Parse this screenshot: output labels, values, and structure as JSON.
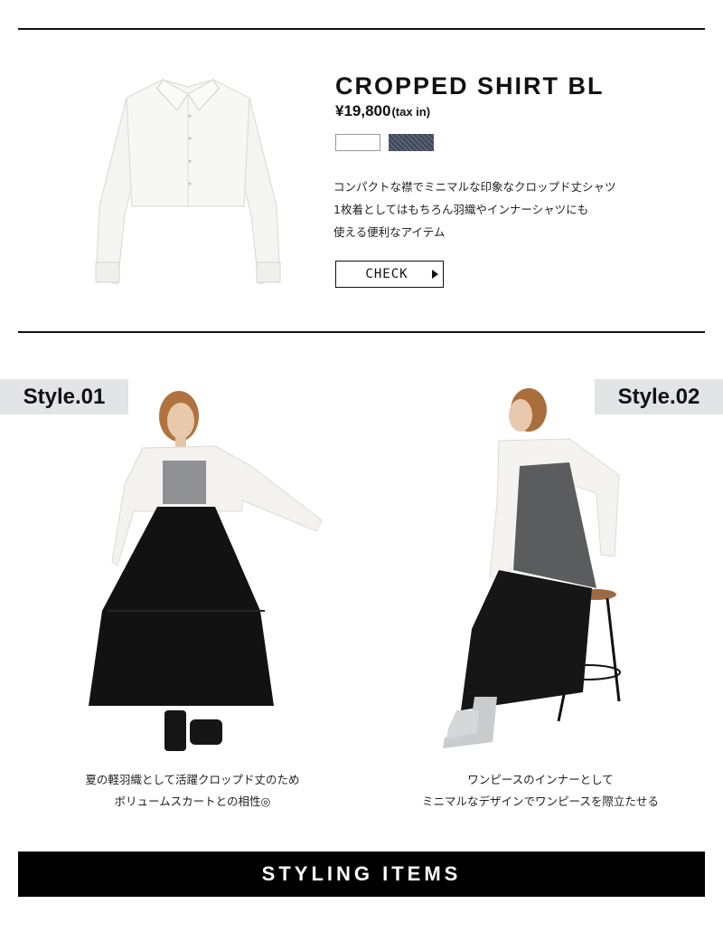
{
  "product": {
    "title": "CROPPED SHIRT BL",
    "price": "¥19,800",
    "price_note": "(tax in)",
    "swatches": [
      "white-swatch",
      "denim-swatch"
    ],
    "description": [
      "コンパクトな襟でミニマルな印象なクロップド丈シャツ",
      "1枚着としてはもちろん羽織やインナーシャツにも",
      "使える便利なアイテム"
    ],
    "cta_label": "CHECK"
  },
  "styles": [
    {
      "tag": "Style.01",
      "caption": [
        "夏の軽羽織として活躍クロップド丈のため",
        "ボリュームスカートとの相性◎"
      ]
    },
    {
      "tag": "Style.02",
      "caption": [
        "ワンピースのインナーとして",
        "ミニマルなデザインでワンピースを際立たせる"
      ]
    }
  ],
  "section_heading": "STYLING ITEMS",
  "colors": {
    "rule": "#111111",
    "tag_bg": "#e3e4e6",
    "bar_bg": "#000000",
    "swatch_white": "#ffffff",
    "swatch_denim": "#4a5263"
  }
}
